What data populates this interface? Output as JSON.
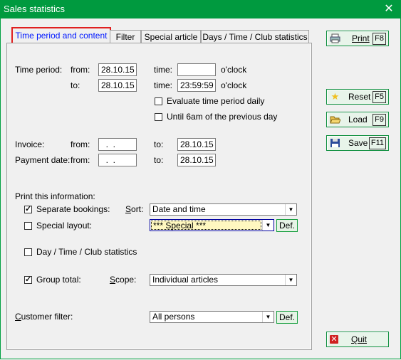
{
  "window": {
    "title": "Sales statistics",
    "close_icon": "close-icon"
  },
  "tabs": [
    {
      "label": "Time period and content",
      "active": true
    },
    {
      "label": "Filter"
    },
    {
      "label": "Special article"
    },
    {
      "label": "Days / Time / Club statistics"
    }
  ],
  "time_period": {
    "label": "Time period:",
    "from_label": "from:",
    "to_label": "to:",
    "from_date": "28.10.15",
    "to_date": "28.10.15",
    "time_label": "time:",
    "from_time": "",
    "to_time": "23:59:59",
    "oclock": "o'clock",
    "evaluate_daily": {
      "label": "Evaluate time period daily",
      "checked": false
    },
    "until_6am": {
      "label": "Until 6am of the previous day",
      "checked": false
    }
  },
  "invoice": {
    "label": "Invoice:",
    "from_label": "from:",
    "from_value": "  .  .",
    "to_label": "to:",
    "to_value": "28.10.15"
  },
  "payment_date": {
    "label": "Payment date:",
    "from_label": "from:",
    "from_value": "  .  .",
    "to_label": "to:",
    "to_value": "28.10.15"
  },
  "print_info": {
    "heading": "Print this information:",
    "separate_bookings": {
      "label": "Separate bookings:",
      "checked": true
    },
    "sort_label": "Sort:",
    "sort_value": "Date and time",
    "special_layout": {
      "label": "Special layout:",
      "checked": false
    },
    "special_value": "*** Special ***",
    "def_label": "Def.",
    "day_time_club": {
      "label": "Day / Time / Club statistics",
      "checked": false
    },
    "group_total": {
      "label": "Group total:",
      "checked": true
    },
    "scope_label": "Scope:",
    "scope_value": "Individual articles"
  },
  "customer_filter": {
    "label": "Customer filter:",
    "value": "All persons",
    "def_label": "Def."
  },
  "side_buttons": {
    "print": {
      "label": "Print",
      "key": "F8",
      "icon": "printer-icon"
    },
    "reset": {
      "label": "Reset",
      "key": "F5",
      "icon": "star-icon"
    },
    "load": {
      "label": "Load",
      "key": "F9",
      "icon": "folder-open-icon"
    },
    "save": {
      "label": "Save",
      "key": "F11",
      "icon": "floppy-disk-icon"
    },
    "quit": {
      "label": "Quit",
      "icon": "close-x-icon"
    }
  },
  "colors": {
    "title_bar": "#009a3f",
    "active_tab_border": "#e02020",
    "active_tab_text": "#0018ff"
  }
}
